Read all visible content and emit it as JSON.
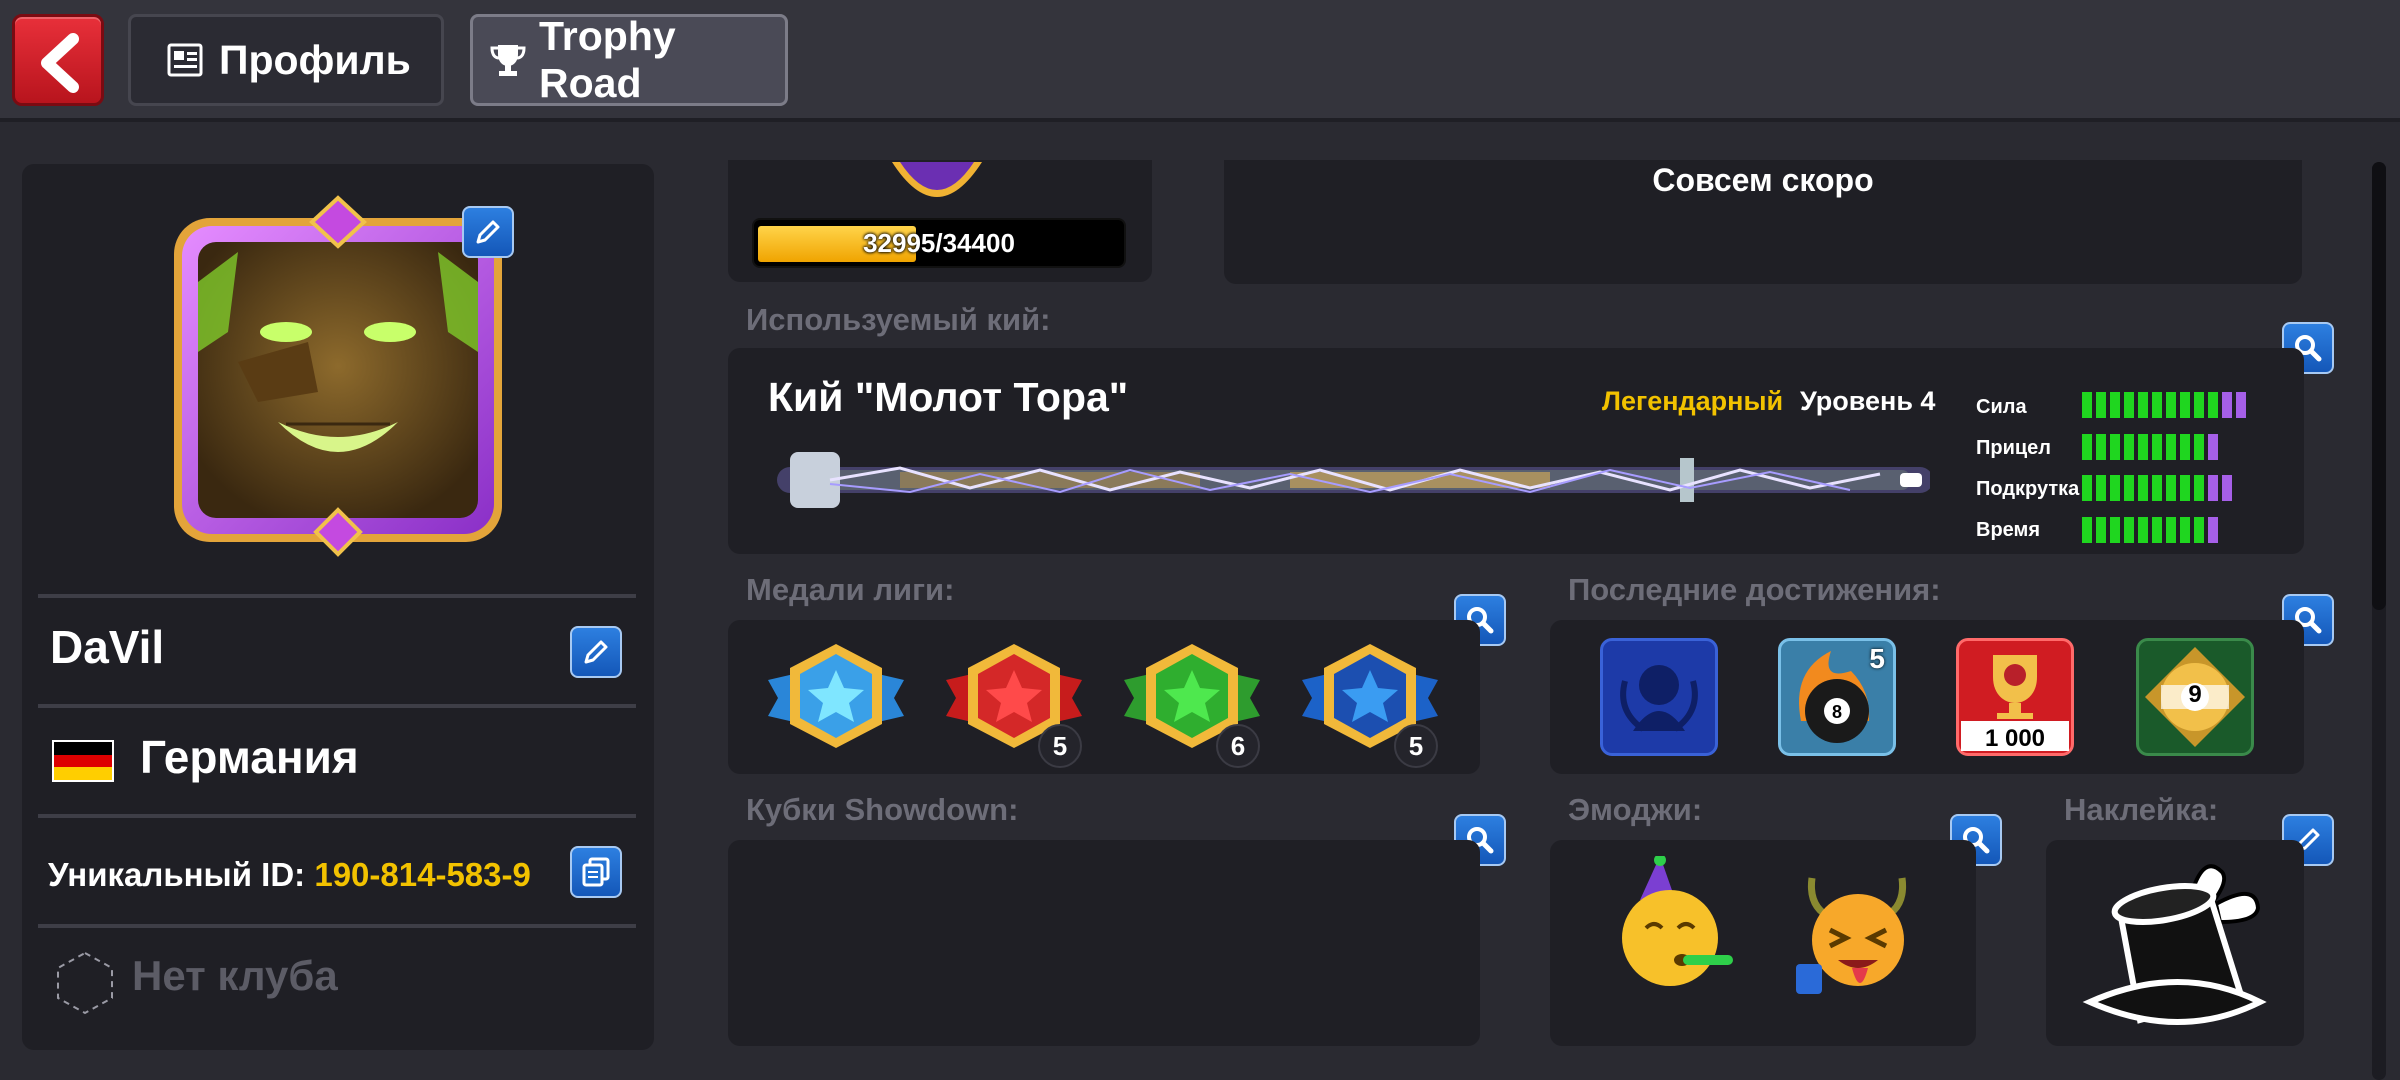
{
  "header": {
    "back_label": "",
    "tabs": [
      {
        "label": "Профиль",
        "icon": "id-card-icon",
        "active": false
      },
      {
        "label": "Trophy Road",
        "icon": "trophy-icon",
        "active": true
      }
    ]
  },
  "profile": {
    "name": "DaVil",
    "country": "Германия",
    "uid_label": "Уникальный ID:",
    "uid_value": "190-814-583-9",
    "club": "Нет клуба"
  },
  "level_progress": {
    "text": "32995/34400",
    "current": 32995,
    "max": 34400
  },
  "coming_soon": "Совсем скоро",
  "cue": {
    "section_label": "Используемый кий:",
    "name": "Кий \"Молот Тора\"",
    "rarity": "Легендарный",
    "level": "Уровень 4",
    "stats": [
      {
        "label": "Сила",
        "filled": 10,
        "bonus": 2
      },
      {
        "label": "Прицел",
        "filled": 9,
        "bonus": 1
      },
      {
        "label": "Подкрутка",
        "filled": 9,
        "bonus": 2
      },
      {
        "label": "Время",
        "filled": 9,
        "bonus": 1
      }
    ]
  },
  "league_medals": {
    "section_label": "Медали лиги:",
    "items": [
      {
        "color": "#3aa0e8",
        "count": ""
      },
      {
        "color": "#d42828",
        "count": "5"
      },
      {
        "color": "#2fae2f",
        "count": "6"
      },
      {
        "color": "#1c62c8",
        "count": "5"
      }
    ]
  },
  "achievements": {
    "section_label": "Последние достижения:",
    "items": [
      {
        "icon": "locked-trophy-icon",
        "text": ""
      },
      {
        "icon": "8-ball-fire-icon",
        "text": "5"
      },
      {
        "icon": "trophy-8-icon",
        "text": "1 000"
      },
      {
        "icon": "9-ball-icon",
        "text": "9"
      }
    ]
  },
  "showdown": {
    "section_label": "Кубки Showdown:"
  },
  "emoji": {
    "section_label": "Эмоджи:"
  },
  "sticker": {
    "section_label": "Наклейка:"
  },
  "colors": {
    "accent_yellow": "#f2c200",
    "button_blue": "#1e6fd0",
    "back_red": "#d3222c"
  }
}
